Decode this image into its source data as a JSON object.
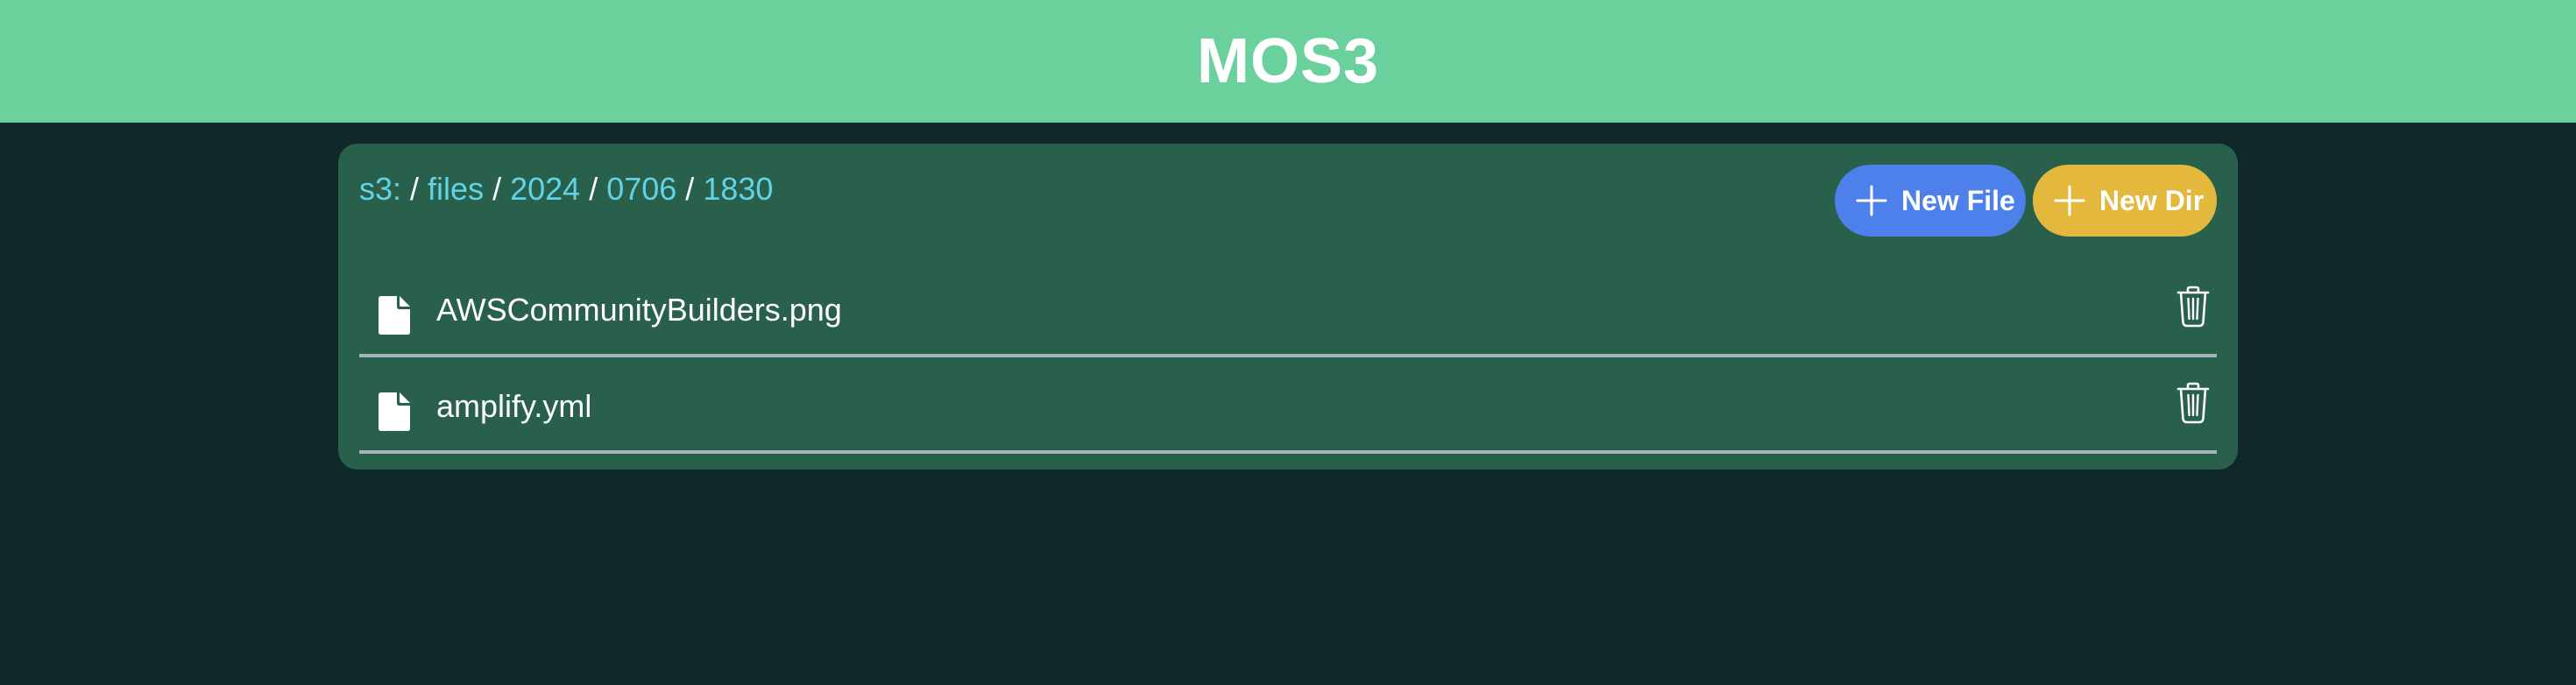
{
  "header": {
    "title": "MOS3"
  },
  "breadcrumb": {
    "root": "s3:",
    "separator": "/",
    "segments": [
      "files",
      "2024",
      "0706",
      "1830"
    ]
  },
  "toolbar": {
    "new_file_label": "New File",
    "new_dir_label": "New Dir"
  },
  "files": [
    {
      "name": "AWSCommunityBuilders.png",
      "icon": "file-icon",
      "action_icon": "trash-icon"
    },
    {
      "name": "amplify.yml",
      "icon": "file-icon",
      "action_icon": "trash-icon"
    }
  ],
  "colors": {
    "header_bg": "#6ad19d",
    "page_bg": "#11282a",
    "panel_bg": "#29604b",
    "link": "#61d3e6",
    "new_file_button": "#4e80ec",
    "new_dir_button": "#e4b73d",
    "divider": "#a7b3bc"
  }
}
